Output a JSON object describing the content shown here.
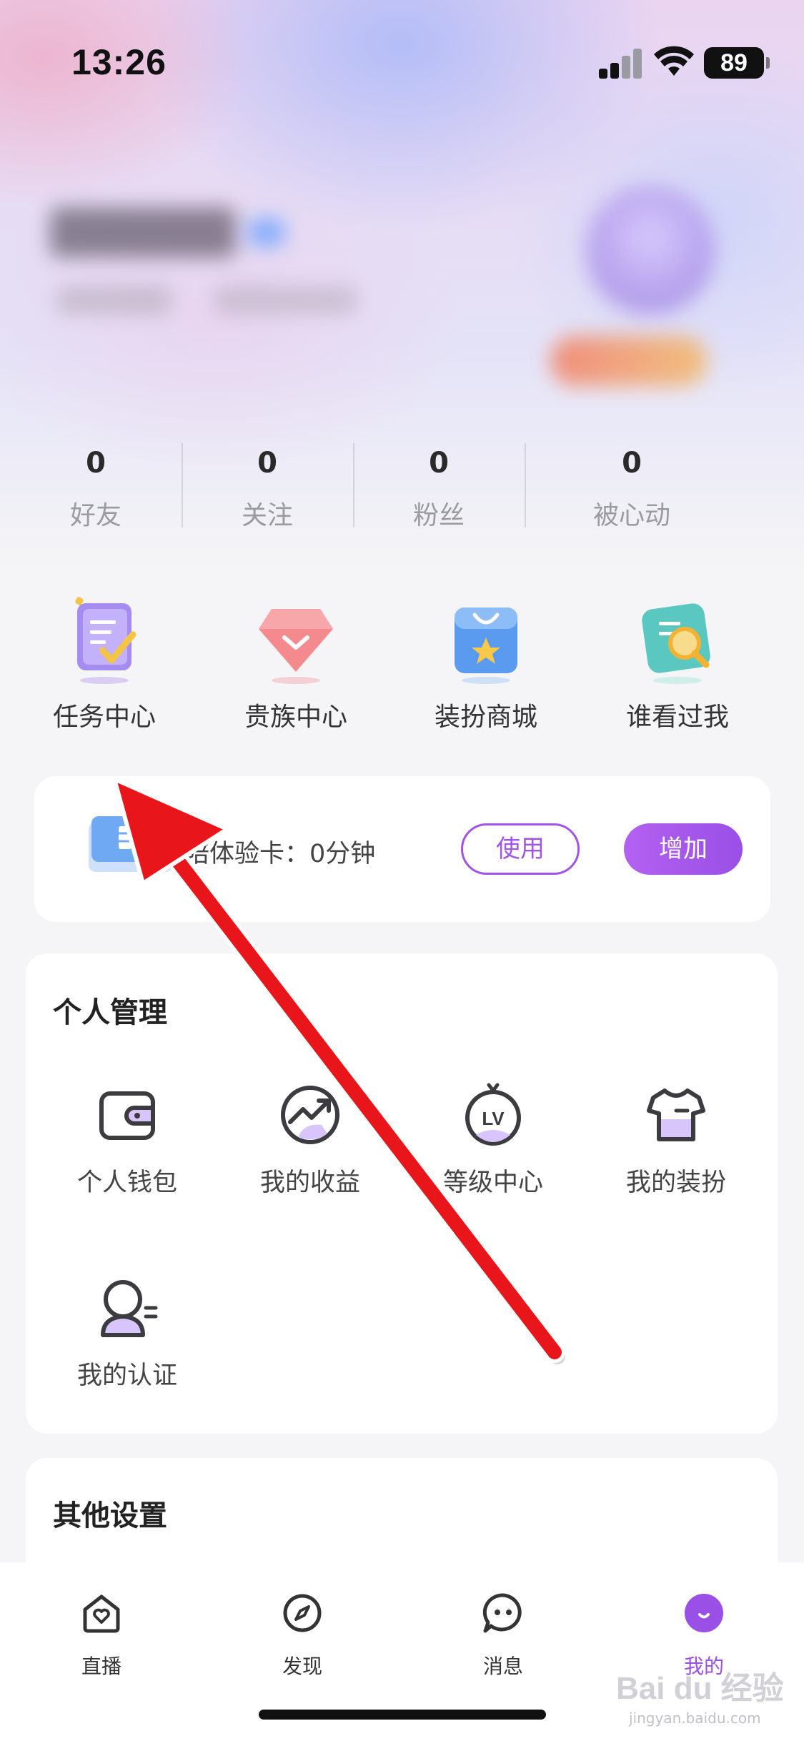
{
  "status_bar": {
    "time": "13:26",
    "battery": "89"
  },
  "stats": [
    {
      "value": "0",
      "label": "好友"
    },
    {
      "value": "0",
      "label": "关注"
    },
    {
      "value": "0",
      "label": "粉丝"
    },
    {
      "value": "0",
      "label": "被心动"
    }
  ],
  "shortcuts": [
    {
      "label": "任务中心",
      "icon": "task-icon"
    },
    {
      "label": "贵族中心",
      "icon": "diamond-icon"
    },
    {
      "label": "装扮商城",
      "icon": "shop-bag-icon"
    },
    {
      "label": "谁看过我",
      "icon": "search-visitors-icon"
    }
  ],
  "experience_card": {
    "text": "陪体验卡：0分钟",
    "use_label": "使用",
    "add_label": "增加"
  },
  "personal_management": {
    "title": "个人管理",
    "items": [
      {
        "label": "个人钱包",
        "icon": "wallet-icon"
      },
      {
        "label": "我的收益",
        "icon": "earnings-icon"
      },
      {
        "label": "等级中心",
        "icon": "level-icon"
      },
      {
        "label": "我的装扮",
        "icon": "outfit-icon"
      },
      {
        "label": "我的认证",
        "icon": "verification-icon"
      }
    ]
  },
  "other_settings": {
    "title": "其他设置"
  },
  "tabbar": [
    {
      "label": "直播",
      "icon": "home-heart-icon"
    },
    {
      "label": "发现",
      "icon": "compass-icon"
    },
    {
      "label": "消息",
      "icon": "chat-icon"
    },
    {
      "label": "我的",
      "icon": "profile-icon"
    }
  ],
  "watermark": {
    "text": "Bai du 经验",
    "sub": "jingyan.baidu.com"
  },
  "colors": {
    "accent": "#9a4fe6",
    "arrow": "#e8161b"
  }
}
